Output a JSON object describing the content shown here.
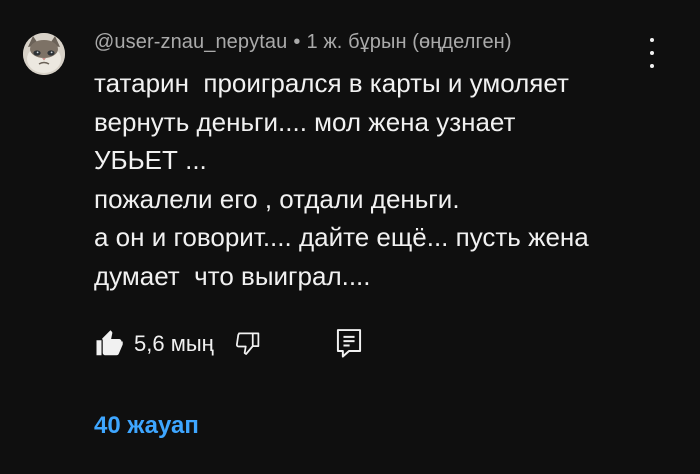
{
  "comment": {
    "author": "@user-znau_nepytau",
    "separator": "•",
    "time": "1 ж. бұрын (өңделген)",
    "lines": [
      "татарин  проигрался в карты и умоляет",
      "вернуть деньги.... мол жена узнает",
      "УБЬЕТ ...",
      "пожалели его , отдали деньги.",
      "а он и говорит.... дайте ещё... пусть жена",
      "думает  что выиграл...."
    ]
  },
  "actions": {
    "like_icon": "thumbs-up-filled-icon",
    "like_count": "5,6 мың",
    "dislike_icon": "thumbs-down-outline-icon",
    "reply_icon": "reply-comment-icon"
  },
  "replies": {
    "label": "40 жауап",
    "color": "#3ea6ff"
  },
  "more_icon": "more-vertical-icon",
  "colors": {
    "background": "#0f0f0f",
    "text": "#f1f1f1",
    "meta": "#aaaaaa"
  }
}
